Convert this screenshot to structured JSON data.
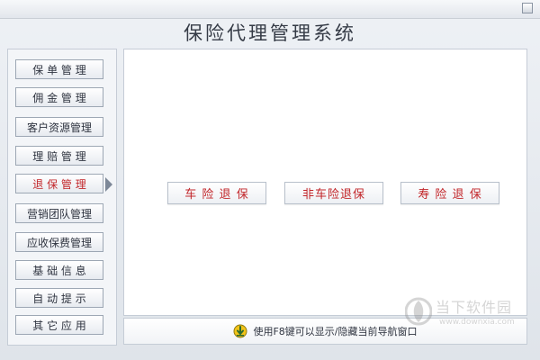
{
  "window": {
    "title": "保险代理管理系统"
  },
  "sidebar": {
    "items": [
      {
        "label": "保 单 管 理"
      },
      {
        "label": "佣 金 管 理"
      },
      {
        "label": "客户资源管理"
      },
      {
        "label": "理 赔 管 理"
      },
      {
        "label": "退 保 管 理",
        "active": true
      },
      {
        "label": "营销团队管理"
      },
      {
        "label": "应收保费管理"
      },
      {
        "label": "基 础 信 息"
      },
      {
        "label": "自 动 提 示"
      },
      {
        "label": "其 它 应 用"
      }
    ]
  },
  "main": {
    "actions": [
      {
        "label": "车 险 退 保"
      },
      {
        "label": "非车险退保"
      },
      {
        "label": "寿 险 退 保"
      }
    ]
  },
  "status": {
    "hint": "使用F8键可以显示/隐藏当前导航窗口",
    "icon": "download-arrow-icon"
  },
  "watermark": {
    "text": "当下软件园",
    "url": "www.downxia.com"
  },
  "colors": {
    "accent_red": "#c2262a",
    "panel_border": "#c5ccd6"
  }
}
